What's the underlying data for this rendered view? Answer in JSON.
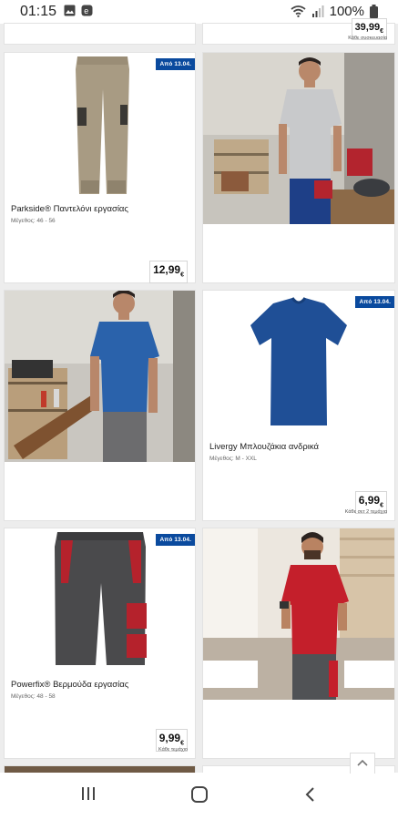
{
  "status": {
    "time": "01:15",
    "battery": "100%"
  },
  "products": [
    {
      "title": "Parkside® Παντελόνι εργασίας",
      "size": "Μέγεθος: 46 - 56",
      "badge": "Από 13.04.",
      "price": "12,99",
      "currency": "€",
      "unit": ""
    },
    {
      "title": "Livergy Μπλουζάκια ανδρικά",
      "size": "Μέγεθος: M - XXL",
      "badge": "Από 13.04.",
      "price": "6,99",
      "currency": "€",
      "unit": "Κάθε σετ 2 τεμάχια"
    },
    {
      "title": "Powerfix® Βερμούδα εργασίας",
      "size": "Μέγεθος: 48 - 58",
      "badge": "Από 13.04.",
      "price": "9,99",
      "currency": "€",
      "unit": "Κάθε τεμάχιο"
    }
  ],
  "top_partial": {
    "price": "39,99",
    "unit": "Κάθε συσκευασία"
  },
  "icons": {
    "gallery": "image-icon",
    "app": "e-app-icon",
    "wifi": "wifi-icon",
    "signal": "signal-icon",
    "battery": "battery-icon",
    "scroll_top": "chevron-up-icon",
    "recents": "recents-icon",
    "home": "home-icon",
    "back": "back-icon"
  },
  "colors": {
    "badge": "#0a4a9e",
    "page_bg": "#ededed"
  }
}
